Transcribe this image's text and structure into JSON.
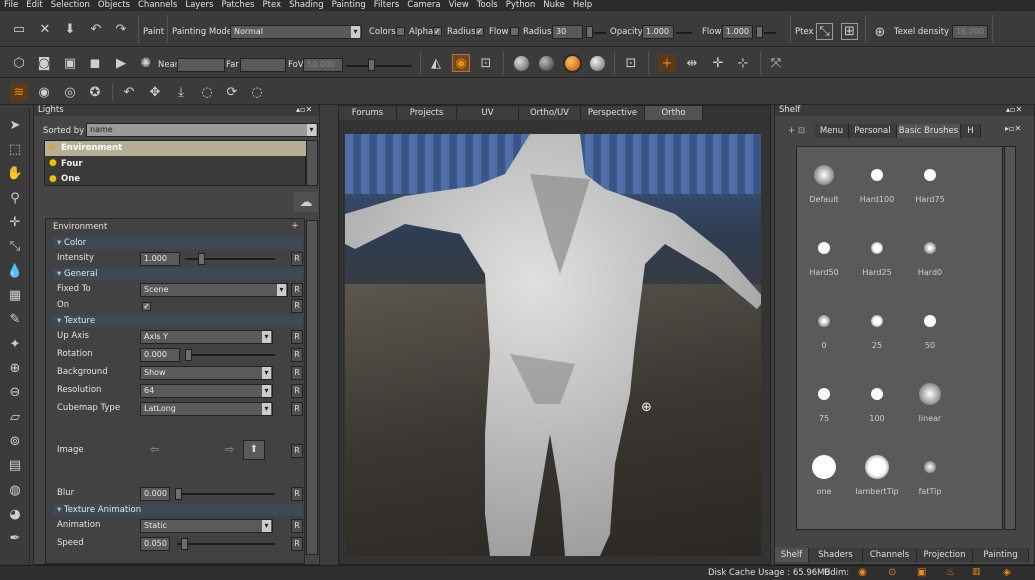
{
  "menu": [
    "File",
    "Edit",
    "Selection",
    "Objects",
    "Channels",
    "Layers",
    "Patches",
    "Ptex",
    "Shading",
    "Painting",
    "Filters",
    "Camera",
    "View",
    "Tools",
    "Python",
    "Nuke",
    "Help"
  ],
  "toolbar1": {
    "paint": "Paint",
    "painting_mode_label": "Painting Mode",
    "painting_mode": "Normal",
    "colors": "Colors",
    "alpha": "Alpha",
    "radius_label": "Radius",
    "flow_label": "Flow",
    "radius2_label": "Radius",
    "radius_value": "30",
    "opacity_label": "Opacity",
    "opacity_value": "1.000",
    "flow2_label": "Flow",
    "flow_value": "1.000",
    "ptex": "Ptex",
    "texel_label": "Texel density :",
    "texel_value": "16.000"
  },
  "toolbar2": {
    "near": "Near",
    "far": "Far",
    "fov": "FoV",
    "fov_value": "50.000"
  },
  "lights": {
    "title": "Lights",
    "sorted_by": "Sorted by",
    "sort_value": "name",
    "items": [
      "Environment",
      "Four",
      "One"
    ]
  },
  "env": {
    "title": "Environment",
    "sec_color": "Color",
    "intensity_label": "Intensity",
    "intensity": "1.000",
    "sec_general": "General",
    "fixed_label": "Fixed To",
    "fixed": "Scene",
    "on_label": "On",
    "sec_texture": "Texture",
    "upaxis_label": "Up Axis",
    "upaxis": "Axis Y",
    "rotation_label": "Rotation",
    "rotation": "0.000",
    "background_label": "Background",
    "background": "Show",
    "resolution_label": "Resolution",
    "resolution": "64",
    "cubemap_label": "Cubemap Type",
    "cubemap": "LatLong",
    "image_label": "Image",
    "blur_label": "Blur",
    "blur": "0.000",
    "sec_anim": "Texture Animation",
    "animation_label": "Animation",
    "animation": "Static",
    "speed_label": "Speed",
    "speed": "0.050",
    "r": "R"
  },
  "viewport_tabs": [
    "Forums",
    "Projects",
    "UV",
    "Ortho/UV",
    "Perspective",
    "Ortho"
  ],
  "shelf": {
    "title": "Shelf",
    "tabs": [
      "Menu",
      "Personal",
      "Basic Brushes",
      "H"
    ],
    "brushes": [
      {
        "name": "Default",
        "size": 20,
        "blur": 1
      },
      {
        "name": "Hard100",
        "size": 12,
        "blur": 0
      },
      {
        "name": "Hard75",
        "size": 12,
        "blur": 0
      },
      {
        "name": "Hard50",
        "size": 12,
        "blur": 0
      },
      {
        "name": "Hard25",
        "size": 12,
        "blur": 0.4
      },
      {
        "name": "Hard0",
        "size": 12,
        "blur": 0.8
      },
      {
        "name": "0",
        "size": 12,
        "blur": 0.8
      },
      {
        "name": "25",
        "size": 12,
        "blur": 0.4
      },
      {
        "name": "50",
        "size": 12,
        "blur": 0
      },
      {
        "name": "75",
        "size": 12,
        "blur": 0
      },
      {
        "name": "100",
        "size": 12,
        "blur": 0
      },
      {
        "name": "linear",
        "size": 22,
        "blur": 1
      },
      {
        "name": "one",
        "size": 24,
        "blur": 0
      },
      {
        "name": "lambertTip",
        "size": 24,
        "blur": 0.3
      },
      {
        "name": "fatTip",
        "size": 12,
        "blur": 1
      }
    ],
    "bottom_tabs": [
      "Shelf",
      "Shaders",
      "Channels",
      "Projection",
      "Painting"
    ]
  },
  "status": {
    "disk": "Disk Cache Usage : 65.96MB",
    "udim": "Udim:"
  },
  "colors": {
    "accent": "#e07a1a",
    "orange": "#f08a10"
  }
}
